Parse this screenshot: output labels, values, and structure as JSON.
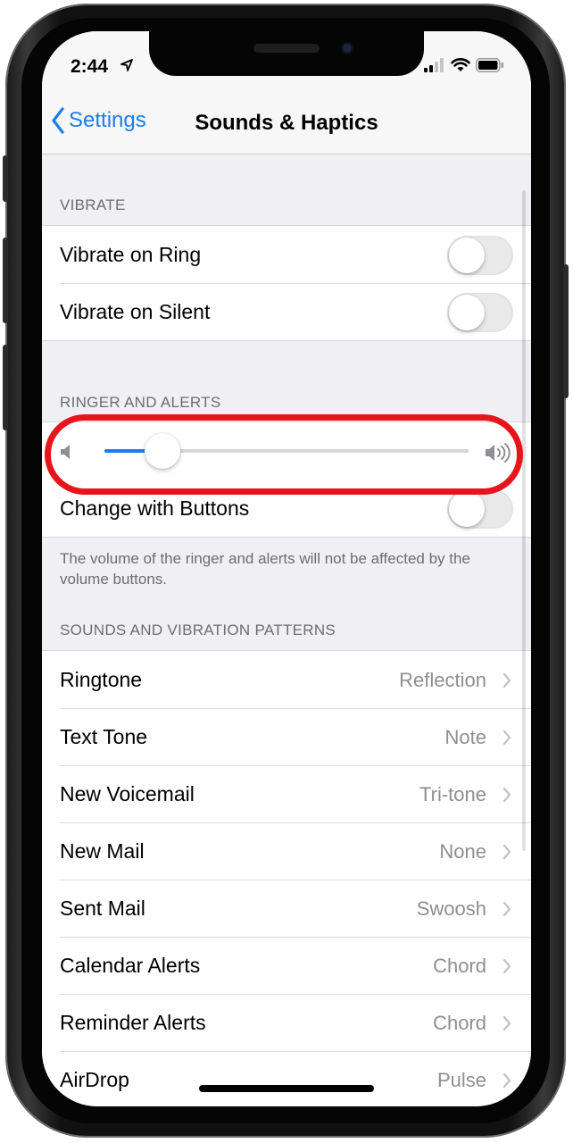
{
  "status_bar": {
    "time": "2:44"
  },
  "nav": {
    "back_label": "Settings",
    "title": "Sounds & Haptics"
  },
  "vibrate": {
    "header": "VIBRATE",
    "items": [
      {
        "label": "Vibrate on Ring",
        "on": false
      },
      {
        "label": "Vibrate on Silent",
        "on": false
      }
    ]
  },
  "ringer": {
    "header": "RINGER AND ALERTS",
    "volume_level": 0.16,
    "change_with_buttons": {
      "label": "Change with Buttons",
      "on": false
    },
    "footer": "The volume of the ringer and alerts will not be affected by the volume buttons."
  },
  "sounds": {
    "header": "SOUNDS AND VIBRATION PATTERNS",
    "items": [
      {
        "label": "Ringtone",
        "value": "Reflection"
      },
      {
        "label": "Text Tone",
        "value": "Note"
      },
      {
        "label": "New Voicemail",
        "value": "Tri-tone"
      },
      {
        "label": "New Mail",
        "value": "None"
      },
      {
        "label": "Sent Mail",
        "value": "Swoosh"
      },
      {
        "label": "Calendar Alerts",
        "value": "Chord"
      },
      {
        "label": "Reminder Alerts",
        "value": "Chord"
      },
      {
        "label": "AirDrop",
        "value": "Pulse"
      }
    ]
  },
  "colors": {
    "accent": "#1b7cf2",
    "highlight": "#e8141c"
  },
  "icons": [
    "location-arrow-icon",
    "cellular-signal-icon",
    "wifi-icon",
    "battery-icon",
    "chevron-left-icon",
    "chevron-right-icon",
    "speaker-low-icon",
    "speaker-high-icon"
  ]
}
